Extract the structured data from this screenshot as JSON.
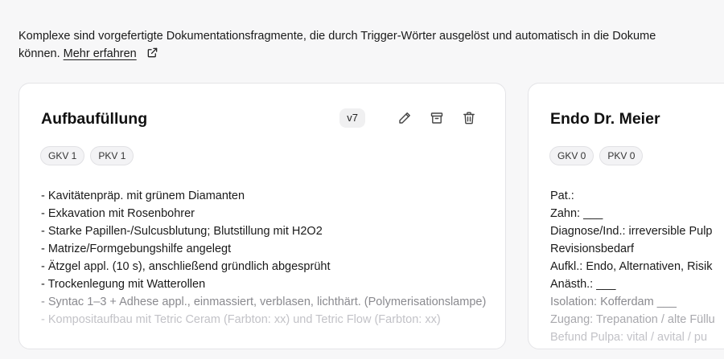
{
  "intro": {
    "line1": "Komplexe sind vorgefertigte Dokumentationsfragmente, die durch Trigger-Wörter ausgelöst und automatisch in die Dokume",
    "line2_prefix": "können.",
    "learn_more": "Mehr erfahren"
  },
  "cards": [
    {
      "title": "Aufbaufüllung",
      "version": "v7",
      "badges": [
        "GKV 1",
        "PKV 1"
      ],
      "lines": [
        "- Kavitätenpräp. mit grünem Diamanten",
        "- Exkavation mit Rosenbohrer",
        "- Starke Papillen-/Sulcusblutung; Blutstillung mit H2O2",
        "- Matrize/Formgebungshilfe angelegt",
        "- Ätzgel appl. (10 s), anschließend gründlich abgesprüht",
        "- Trockenlegung mit Watterollen",
        "- Syntac 1–3 + Adhese appl., einmassiert, verblasen, lichthärt. (Polymerisationslampe)",
        "- Kompositaufbau mit Tetric Ceram (Farbton: xx) und Tetric Flow (Farbton: xx)"
      ]
    },
    {
      "title": "Endo Dr. Meier",
      "badges": [
        "GKV 0",
        "PKV 0"
      ],
      "lines": [
        "Pat.:",
        "Zahn: ___",
        "Diagnose/Ind.: irreversible Pulp",
        "Revisionsbedarf",
        "Aufkl.: Endo, Alternativen, Risik",
        "Anästh.: ___",
        "Isolation: Kofferdam ___",
        "Zugang: Trepanation / alte Füllu",
        "Befund Pulpa: vital / avital / pu"
      ]
    }
  ],
  "colors": {
    "text": "#1a1a1a",
    "card_border": "#e4e4e7",
    "badge_bg": "#f3f3f5"
  },
  "icons": [
    "external-link-icon",
    "pencil-icon",
    "archive-icon",
    "trash-icon"
  ]
}
